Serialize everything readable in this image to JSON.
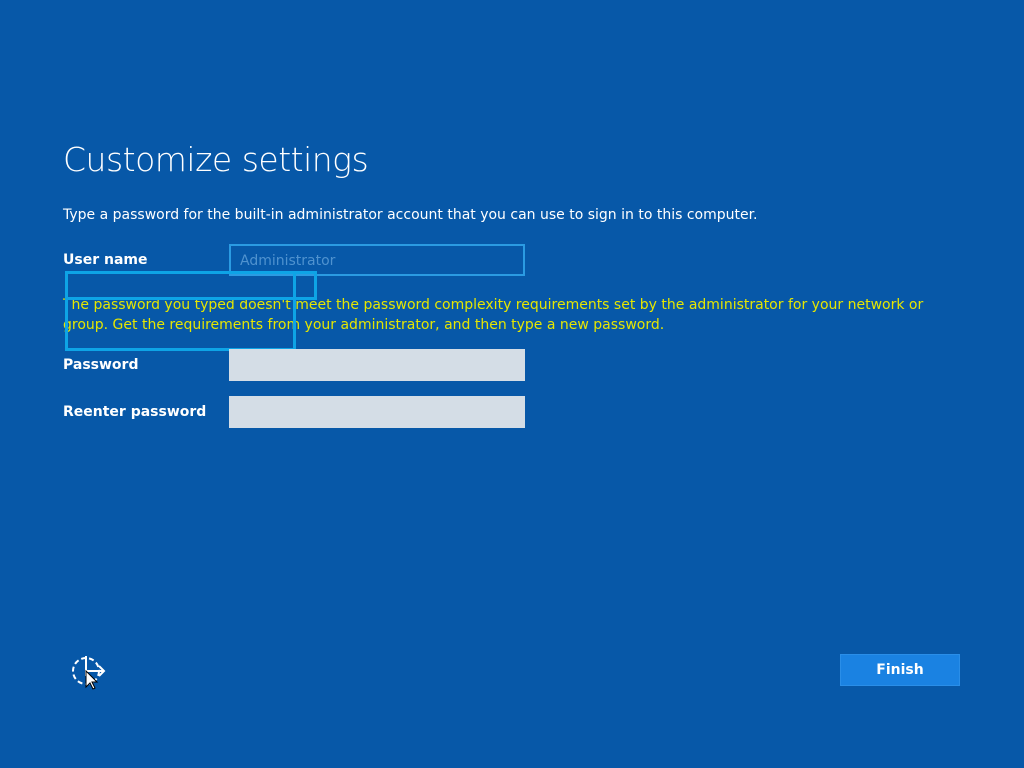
{
  "header": {
    "title": "Customize settings"
  },
  "instructions": "Type a password for the built-in administrator account that you can use to sign in to this computer.",
  "form": {
    "username_label": "User name",
    "username_value": "Administrator",
    "error_message": "The password you typed doesn't meet the password complexity requirements set by the administrator for your network or group. Get the requirements from your administrator, and then type a new password.",
    "password_label": "Password",
    "password_value": "",
    "reenter_label": "Reenter password",
    "reenter_value": ""
  },
  "footer": {
    "ease_of_access_icon": "ease-of-access-icon",
    "finish_label": "Finish"
  },
  "colors": {
    "background": "#0758a8",
    "error_text": "#e6e600",
    "accent": "#1a82e2",
    "focus": "#0ea4e6"
  }
}
